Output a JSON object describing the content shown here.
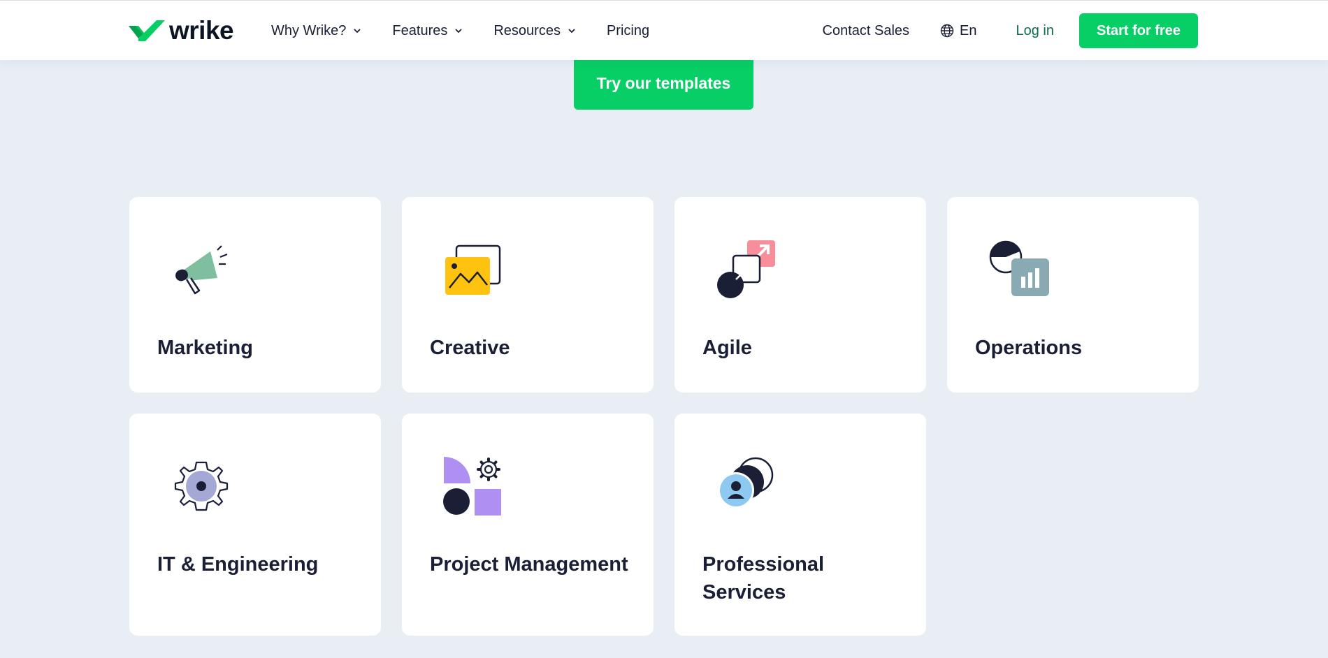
{
  "header": {
    "logo_text": "wrike",
    "nav": [
      {
        "label": "Why Wrike?",
        "dropdown": true
      },
      {
        "label": "Features",
        "dropdown": true
      },
      {
        "label": "Resources",
        "dropdown": true
      },
      {
        "label": "Pricing",
        "dropdown": false
      }
    ],
    "contact_label": "Contact Sales",
    "language_label": "En",
    "login_label": "Log in",
    "start_label": "Start for free"
  },
  "cta_label": "Try our templates",
  "cards": [
    {
      "label": "Marketing",
      "icon": "megaphone-icon"
    },
    {
      "label": "Creative",
      "icon": "image-icon"
    },
    {
      "label": "Agile",
      "icon": "arrow-nodes-icon"
    },
    {
      "label": "Operations",
      "icon": "chart-icon"
    },
    {
      "label": "IT & Engineering",
      "icon": "gear-icon"
    },
    {
      "label": "Project Management",
      "icon": "shapes-icon"
    },
    {
      "label": "Professional Services",
      "icon": "people-icon"
    }
  ],
  "colors": {
    "brand_green": "#08cf65",
    "background": "#e9edf4",
    "text_dark": "#1a1f36",
    "login_green": "#0a6b4f"
  }
}
